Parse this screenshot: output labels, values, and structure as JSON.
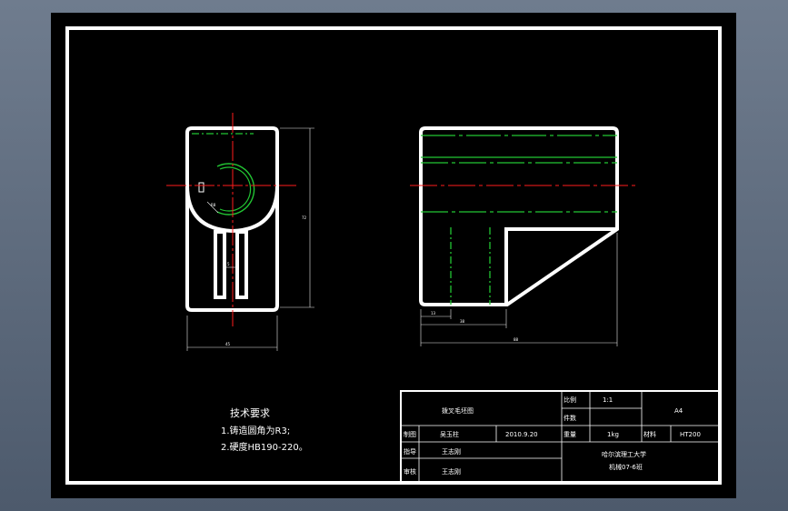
{
  "colors": {
    "background": "#000000",
    "outline": "#ffffff",
    "hidden_line": "#22c533",
    "center_line": "#ff1c1c"
  },
  "tech_requirements": {
    "heading": "技术要求",
    "items": [
      "1.铸造圆角为R3;",
      "2.硬度HB190-220。"
    ]
  },
  "dimensions": {
    "left_width": "45",
    "left_height": "72",
    "slot_width": "5",
    "radius": "R8",
    "right_small": "13",
    "right_mid": "38",
    "right_total": "88"
  },
  "title_block": {
    "part_name": "拨叉毛坯图",
    "scale_label": "比例",
    "scale_value": "1:1",
    "count_label": "件数",
    "drawing_no": "A4",
    "drawn_label": "制图",
    "drawn_name": "吴玉柱",
    "drawn_date": "2010.9.20",
    "weight_label": "重量",
    "weight_value": "1kg",
    "material_label": "材料",
    "material_value": "HT200",
    "guide_label": "指导",
    "guide_name": "王志刚",
    "review_label": "审核",
    "review_name": "王志刚",
    "school": "哈尔滨理工大学",
    "class_name": "机械07-6班"
  }
}
